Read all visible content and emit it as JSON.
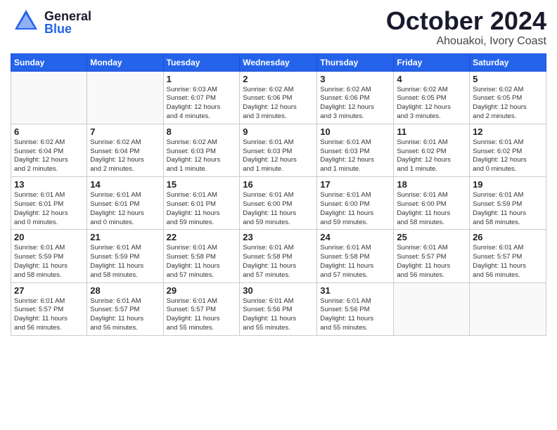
{
  "logo": {
    "general": "General",
    "blue": "Blue"
  },
  "title": {
    "month_year": "October 2024",
    "location": "Ahouakoi, Ivory Coast"
  },
  "weekdays": [
    "Sunday",
    "Monday",
    "Tuesday",
    "Wednesday",
    "Thursday",
    "Friday",
    "Saturday"
  ],
  "weeks": [
    [
      {
        "day": "",
        "info": ""
      },
      {
        "day": "",
        "info": ""
      },
      {
        "day": "1",
        "info": "Sunrise: 6:03 AM\nSunset: 6:07 PM\nDaylight: 12 hours\nand 4 minutes."
      },
      {
        "day": "2",
        "info": "Sunrise: 6:02 AM\nSunset: 6:06 PM\nDaylight: 12 hours\nand 3 minutes."
      },
      {
        "day": "3",
        "info": "Sunrise: 6:02 AM\nSunset: 6:06 PM\nDaylight: 12 hours\nand 3 minutes."
      },
      {
        "day": "4",
        "info": "Sunrise: 6:02 AM\nSunset: 6:05 PM\nDaylight: 12 hours\nand 3 minutes."
      },
      {
        "day": "5",
        "info": "Sunrise: 6:02 AM\nSunset: 6:05 PM\nDaylight: 12 hours\nand 2 minutes."
      }
    ],
    [
      {
        "day": "6",
        "info": "Sunrise: 6:02 AM\nSunset: 6:04 PM\nDaylight: 12 hours\nand 2 minutes."
      },
      {
        "day": "7",
        "info": "Sunrise: 6:02 AM\nSunset: 6:04 PM\nDaylight: 12 hours\nand 2 minutes."
      },
      {
        "day": "8",
        "info": "Sunrise: 6:02 AM\nSunset: 6:03 PM\nDaylight: 12 hours\nand 1 minute."
      },
      {
        "day": "9",
        "info": "Sunrise: 6:01 AM\nSunset: 6:03 PM\nDaylight: 12 hours\nand 1 minute."
      },
      {
        "day": "10",
        "info": "Sunrise: 6:01 AM\nSunset: 6:03 PM\nDaylight: 12 hours\nand 1 minute."
      },
      {
        "day": "11",
        "info": "Sunrise: 6:01 AM\nSunset: 6:02 PM\nDaylight: 12 hours\nand 1 minute."
      },
      {
        "day": "12",
        "info": "Sunrise: 6:01 AM\nSunset: 6:02 PM\nDaylight: 12 hours\nand 0 minutes."
      }
    ],
    [
      {
        "day": "13",
        "info": "Sunrise: 6:01 AM\nSunset: 6:01 PM\nDaylight: 12 hours\nand 0 minutes."
      },
      {
        "day": "14",
        "info": "Sunrise: 6:01 AM\nSunset: 6:01 PM\nDaylight: 12 hours\nand 0 minutes."
      },
      {
        "day": "15",
        "info": "Sunrise: 6:01 AM\nSunset: 6:01 PM\nDaylight: 11 hours\nand 59 minutes."
      },
      {
        "day": "16",
        "info": "Sunrise: 6:01 AM\nSunset: 6:00 PM\nDaylight: 11 hours\nand 59 minutes."
      },
      {
        "day": "17",
        "info": "Sunrise: 6:01 AM\nSunset: 6:00 PM\nDaylight: 11 hours\nand 59 minutes."
      },
      {
        "day": "18",
        "info": "Sunrise: 6:01 AM\nSunset: 6:00 PM\nDaylight: 11 hours\nand 58 minutes."
      },
      {
        "day": "19",
        "info": "Sunrise: 6:01 AM\nSunset: 5:59 PM\nDaylight: 11 hours\nand 58 minutes."
      }
    ],
    [
      {
        "day": "20",
        "info": "Sunrise: 6:01 AM\nSunset: 5:59 PM\nDaylight: 11 hours\nand 58 minutes."
      },
      {
        "day": "21",
        "info": "Sunrise: 6:01 AM\nSunset: 5:59 PM\nDaylight: 11 hours\nand 58 minutes."
      },
      {
        "day": "22",
        "info": "Sunrise: 6:01 AM\nSunset: 5:58 PM\nDaylight: 11 hours\nand 57 minutes."
      },
      {
        "day": "23",
        "info": "Sunrise: 6:01 AM\nSunset: 5:58 PM\nDaylight: 11 hours\nand 57 minutes."
      },
      {
        "day": "24",
        "info": "Sunrise: 6:01 AM\nSunset: 5:58 PM\nDaylight: 11 hours\nand 57 minutes."
      },
      {
        "day": "25",
        "info": "Sunrise: 6:01 AM\nSunset: 5:57 PM\nDaylight: 11 hours\nand 56 minutes."
      },
      {
        "day": "26",
        "info": "Sunrise: 6:01 AM\nSunset: 5:57 PM\nDaylight: 11 hours\nand 56 minutes."
      }
    ],
    [
      {
        "day": "27",
        "info": "Sunrise: 6:01 AM\nSunset: 5:57 PM\nDaylight: 11 hours\nand 56 minutes."
      },
      {
        "day": "28",
        "info": "Sunrise: 6:01 AM\nSunset: 5:57 PM\nDaylight: 11 hours\nand 56 minutes."
      },
      {
        "day": "29",
        "info": "Sunrise: 6:01 AM\nSunset: 5:57 PM\nDaylight: 11 hours\nand 55 minutes."
      },
      {
        "day": "30",
        "info": "Sunrise: 6:01 AM\nSunset: 5:56 PM\nDaylight: 11 hours\nand 55 minutes."
      },
      {
        "day": "31",
        "info": "Sunrise: 6:01 AM\nSunset: 5:56 PM\nDaylight: 11 hours\nand 55 minutes."
      },
      {
        "day": "",
        "info": ""
      },
      {
        "day": "",
        "info": ""
      }
    ]
  ]
}
